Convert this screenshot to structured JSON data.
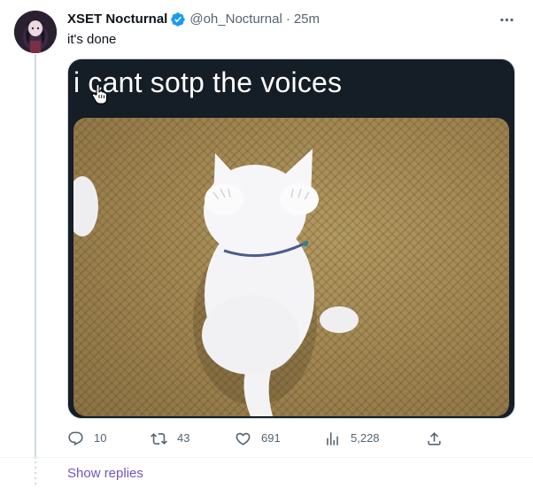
{
  "tweet": {
    "author_name": "XSET Nocturnal",
    "handle": "@oh_Nocturnal",
    "separator": "·",
    "time": "25m",
    "text": "it's done",
    "verified_color": "#1d9bf0"
  },
  "media": {
    "caption": "i cant sotp the voices",
    "subject": "white kitten covering ears on tatami mat"
  },
  "actions": {
    "replies": "10",
    "retweets": "43",
    "likes": "691",
    "views": "5,228"
  },
  "footer": {
    "show_replies": "Show replies"
  },
  "colors": {
    "text_primary": "#0f1419",
    "text_secondary": "#536471",
    "link": "#6f55c8",
    "media_bg": "#151d26"
  },
  "icons": [
    "more-icon",
    "verified-icon",
    "reply-icon",
    "retweet-icon",
    "like-icon",
    "views-icon",
    "share-icon"
  ]
}
